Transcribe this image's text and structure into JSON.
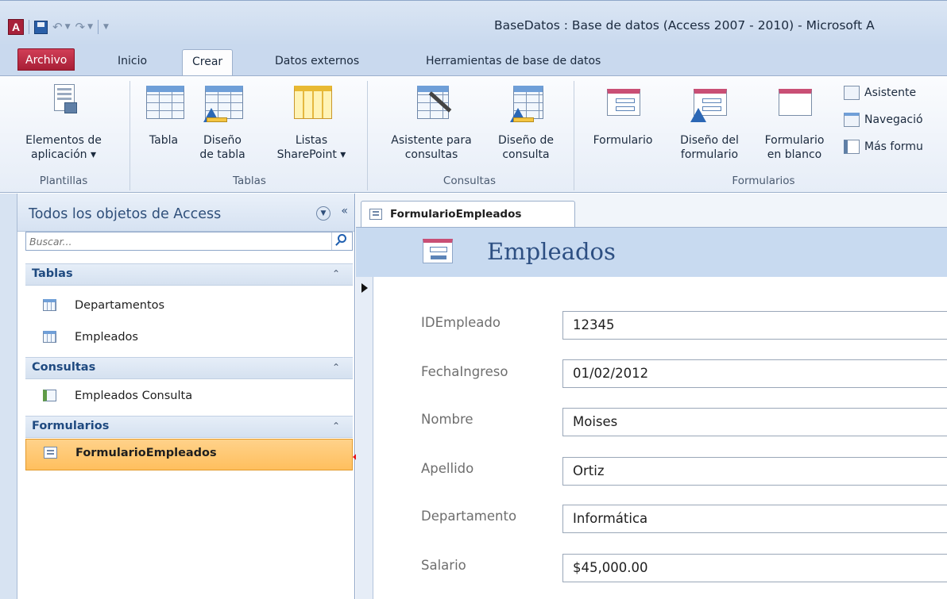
{
  "window": {
    "title": "BaseDatos : Base de datos (Access 2007 - 2010)  -  Microsoft A",
    "app_icon": "A"
  },
  "ribbon": {
    "tabs": [
      {
        "label": "Archivo"
      },
      {
        "label": "Inicio"
      },
      {
        "label": "Crear"
      },
      {
        "label": "Datos externos"
      },
      {
        "label": "Herramientas de base de datos"
      }
    ],
    "active_tab": "Crear",
    "groups": {
      "plantillas": {
        "label": "Plantillas",
        "buttons": [
          {
            "line1": "Elementos de",
            "line2": "aplicación ▾"
          }
        ]
      },
      "tablas": {
        "label": "Tablas",
        "buttons": [
          {
            "line1": "Tabla",
            "line2": ""
          },
          {
            "line1": "Diseño",
            "line2": "de tabla"
          },
          {
            "line1": "Listas",
            "line2": "SharePoint ▾"
          }
        ]
      },
      "consultas": {
        "label": "Consultas",
        "buttons": [
          {
            "line1": "Asistente para",
            "line2": "consultas"
          },
          {
            "line1": "Diseño de",
            "line2": "consulta"
          }
        ]
      },
      "formularios": {
        "label": "Formularios",
        "buttons": [
          {
            "line1": "Formulario",
            "line2": ""
          },
          {
            "line1": "Diseño del",
            "line2": "formulario"
          },
          {
            "line1": "Formulario",
            "line2": "en blanco"
          }
        ],
        "small_buttons": [
          {
            "label": "Asistente",
            "icon": "wizard-icon"
          },
          {
            "label": "Navegació",
            "icon": "navigation-icon"
          },
          {
            "label": "Más formu",
            "icon": "more-forms-icon"
          }
        ]
      }
    }
  },
  "nav_pane": {
    "title": "Todos los objetos de Access",
    "search_placeholder": "Buscar...",
    "collapse_glyph": "«",
    "dropdown_glyph": "▼",
    "groups": [
      {
        "label": "Tablas",
        "chevron": "⌃",
        "items": [
          {
            "label": "Departamentos",
            "icon": "table-icon"
          },
          {
            "label": "Empleados",
            "icon": "table-icon"
          }
        ]
      },
      {
        "label": "Consultas",
        "chevron": "⌃",
        "items": [
          {
            "label": "Empleados Consulta",
            "icon": "query-icon"
          }
        ]
      },
      {
        "label": "Formularios",
        "chevron": "⌃",
        "items": [
          {
            "label": "FormularioEmpleados",
            "icon": "form-icon",
            "selected": true
          }
        ]
      }
    ]
  },
  "document": {
    "tab_label": "FormularioEmpleados",
    "form_title": "Empleados",
    "fields": [
      {
        "label": "IDEmpleado",
        "value": "12345"
      },
      {
        "label": "FechaIngreso",
        "value": "01/02/2012"
      },
      {
        "label": "Nombre",
        "value": "Moises"
      },
      {
        "label": "Apellido",
        "value": "Ortiz"
      },
      {
        "label": "Departamento",
        "value": "Informática"
      },
      {
        "label": "Salario",
        "value": "$45,000.00"
      }
    ]
  },
  "annotation": {
    "arrow_color": "#e3141b"
  }
}
